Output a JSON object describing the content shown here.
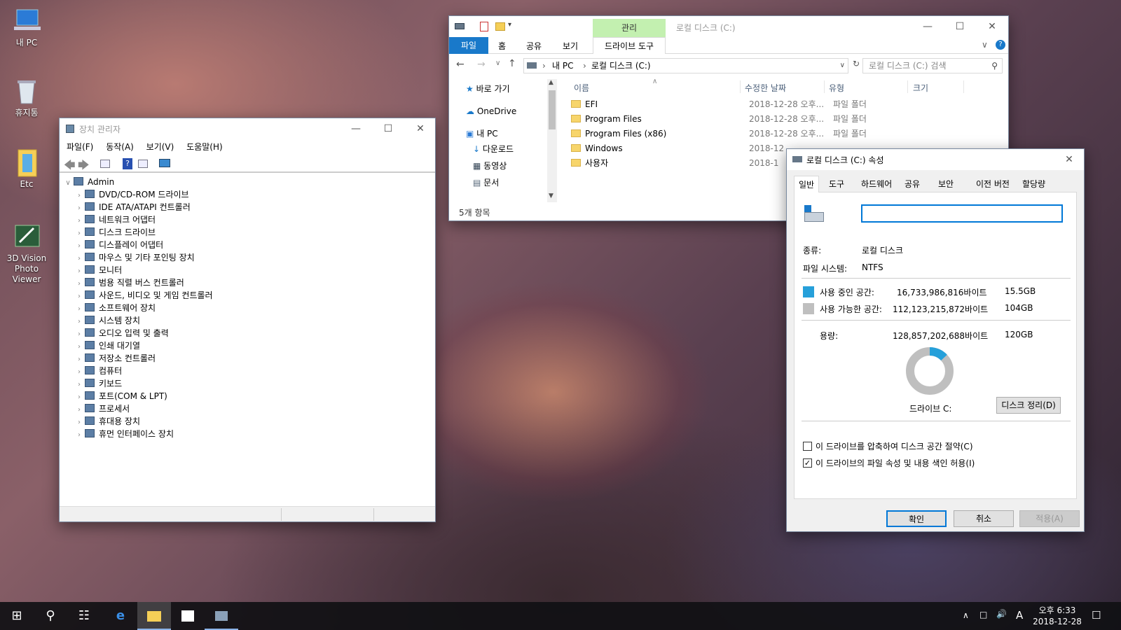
{
  "desktop": {
    "icons": [
      {
        "label": "내 PC"
      },
      {
        "label": "휴지통"
      },
      {
        "label": "Etc"
      },
      {
        "label": "3D Vision Photo Viewer"
      }
    ]
  },
  "devmgr": {
    "title": "장치 관리자",
    "menu": [
      "파일(F)",
      "동작(A)",
      "보기(V)",
      "도움말(H)"
    ],
    "root": "Admin",
    "items": [
      "DVD/CD-ROM 드라이브",
      "IDE ATA/ATAPI 컨트롤러",
      "네트워크 어댑터",
      "디스크 드라이브",
      "디스플레이 어댑터",
      "마우스 및 기타 포인팅 장치",
      "모니터",
      "범용 직렬 버스 컨트롤러",
      "사운드, 비디오 및 게임 컨트롤러",
      "소프트웨어 장치",
      "시스템 장치",
      "오디오 입력 및 출력",
      "인쇄 대기열",
      "저장소 컨트롤러",
      "컴퓨터",
      "키보드",
      "포트(COM & LPT)",
      "프로세서",
      "휴대용 장치",
      "휴먼 인터페이스 장치"
    ]
  },
  "explorer": {
    "title": "로컬 디스크 (C:)",
    "context_tab": "관리",
    "tabs": [
      "파일",
      "홈",
      "공유",
      "보기",
      "드라이브 도구"
    ],
    "breadcrumb": [
      "내 PC",
      "로컬 디스크 (C:)"
    ],
    "search_placeholder": "로컬 디스크 (C:) 검색",
    "nav": [
      "바로 가기",
      "OneDrive",
      "내 PC",
      "다운로드",
      "동영상",
      "문서"
    ],
    "columns": [
      "이름",
      "수정한 날짜",
      "유형",
      "크기"
    ],
    "files": [
      {
        "name": "EFI",
        "date": "2018-12-28 오후...",
        "type": "파일 폴더"
      },
      {
        "name": "Program Files",
        "date": "2018-12-28 오후...",
        "type": "파일 폴더"
      },
      {
        "name": "Program Files (x86)",
        "date": "2018-12-28 오후...",
        "type": "파일 폴더"
      },
      {
        "name": "Windows",
        "date": "2018-12",
        "type": ""
      },
      {
        "name": "사용자",
        "date": "2018-1",
        "type": ""
      }
    ],
    "status": "5개 항목"
  },
  "props": {
    "title": "로컬 디스크 (C:) 속성",
    "tabs": [
      "일반",
      "도구",
      "하드웨어",
      "공유",
      "보안",
      "이전 버전",
      "할당량"
    ],
    "name_value": "",
    "type_label": "종류:",
    "type_value": "로컬 디스크",
    "fs_label": "파일 시스템:",
    "fs_value": "NTFS",
    "used_label": "사용 중인 공간:",
    "used_bytes": "16,733,986,816바이트",
    "used_gb": "15.5GB",
    "free_label": "사용 가능한 공간:",
    "free_bytes": "112,123,215,872바이트",
    "free_gb": "104GB",
    "cap_label": "용량:",
    "cap_bytes": "128,857,202,688바이트",
    "cap_gb": "120GB",
    "used_fraction": 0.13,
    "drive_label": "드라이브 C:",
    "cleanup": "디스크 정리(D)",
    "compress": "이 드라이브를 압축하여 디스크 공간 절약(C)",
    "index": "이 드라이브의 파일 속성 및 내용 색인 허용(I)",
    "index_checked": true,
    "ok": "확인",
    "cancel": "취소",
    "apply": "적용(A)",
    "used_color": "#26a0da",
    "free_color": "#bfbfbf"
  },
  "tray": {
    "ime": "A",
    "time": "오후 6:33",
    "date": "2018-12-28"
  }
}
